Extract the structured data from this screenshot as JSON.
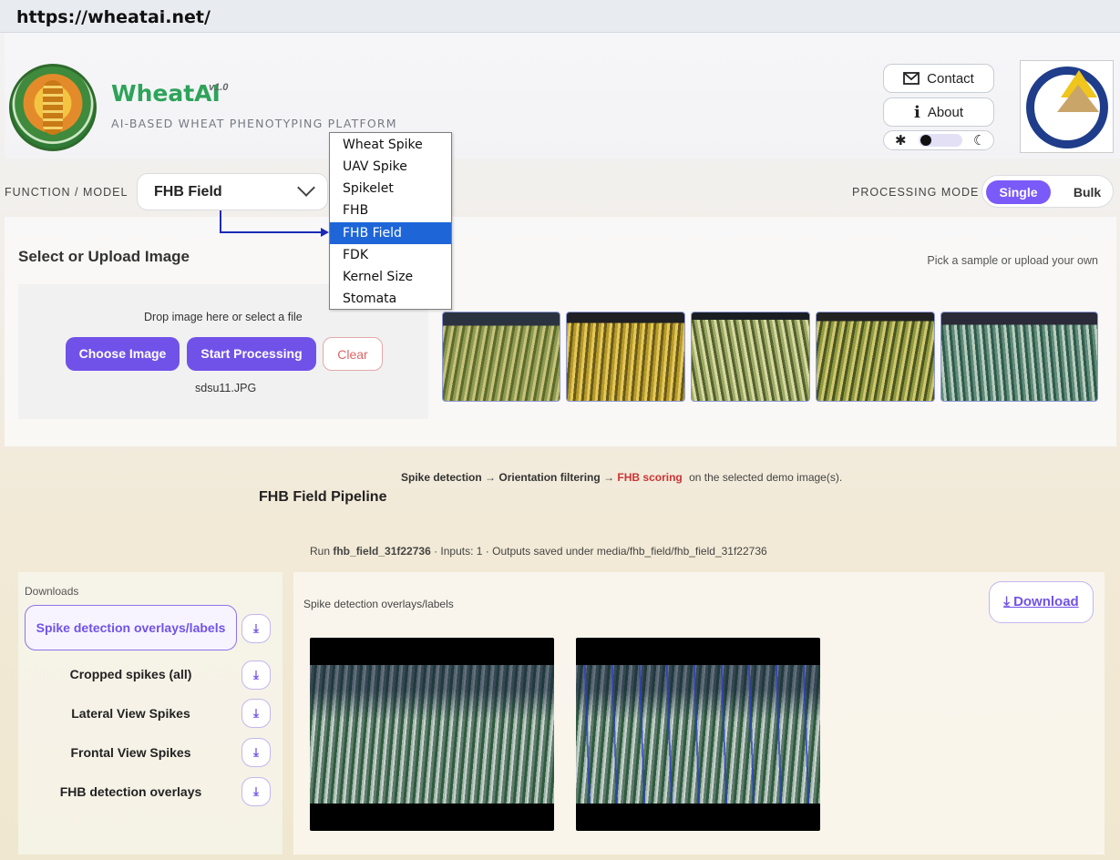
{
  "url": "https://wheatai.net/",
  "header": {
    "brand": "WheatAI",
    "version": "v1.0",
    "tagline": "AI-BASED WHEAT PHENOTYPING PLATFORM",
    "contact_label": "Contact",
    "about_label": "About",
    "theme_sun": "✱",
    "theme_moon": "☾"
  },
  "controls": {
    "function_label": "FUNCTION / MODEL",
    "function_value": "FHB Field",
    "processing_label": "PROCESSING MODE",
    "single_label": "Single",
    "bulk_label": "Bulk"
  },
  "dropdown": {
    "items": [
      "Wheat Spike",
      "UAV Spike",
      "Spikelet",
      "FHB",
      "FHB Field",
      "FDK",
      "Kernel Size",
      "Stomata"
    ],
    "selected": "FHB Field"
  },
  "upload": {
    "title": "Select or Upload Image",
    "hint": "Pick a sample or upload your own",
    "drop_text": "Drop image here or select a file",
    "choose_label": "Choose Image",
    "start_label": "Start Processing",
    "clear_label": "Clear",
    "filename": "sdsu11.JPG"
  },
  "pipeline": {
    "step1": "Spike detection",
    "arrow": "→",
    "step2": "Orientation filtering",
    "step3": "FHB scoring",
    "suffix": "on the selected demo image(s).",
    "title": "FHB Field Pipeline",
    "run_prefix": "Run",
    "run_id": "fhb_field_31f22736",
    "run_suffix": "· Inputs: 1 · Outputs saved under media/fhb_field/fhb_field_31f22736"
  },
  "downloads": {
    "label": "Downloads",
    "items": [
      "Spike detection overlays/labels",
      "Cropped spikes (all)",
      "Lateral View Spikes",
      "Frontal View Spikes",
      "FHB detection overlays"
    ],
    "icon": "⤓"
  },
  "results": {
    "label": "Spike detection overlays/labels",
    "download_label": "⤓ Download"
  },
  "colors": {
    "accent": "#7152e8",
    "brand_green": "#2ea35a",
    "menu_selected": "#1e66d8",
    "annotation_arrow": "#1c2bb5"
  }
}
